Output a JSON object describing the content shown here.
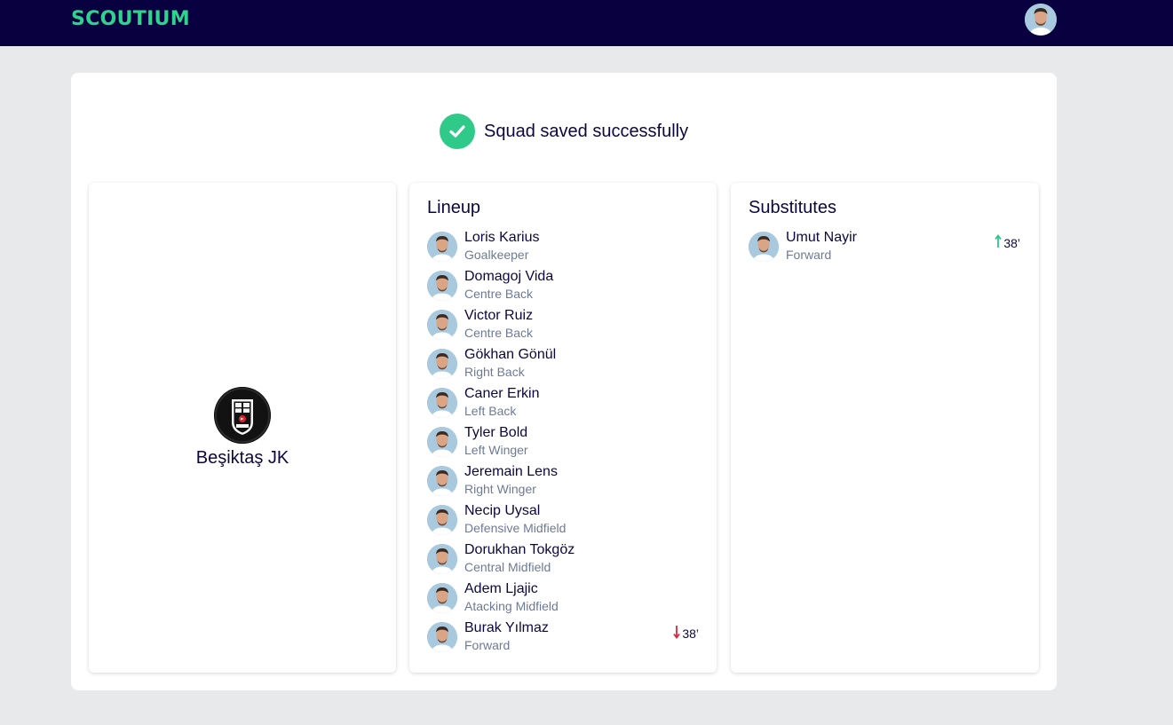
{
  "header": {
    "logo": "SCOUTIUM",
    "avatar_icon": "user-avatar-icon"
  },
  "status": {
    "message": "Squad saved successfully",
    "icon": "check-icon",
    "color": "#2fc98a"
  },
  "team": {
    "name": "Beşiktaş JK",
    "logo_icon": "besiktas-crest-icon"
  },
  "lineup": {
    "title": "Lineup",
    "players": [
      {
        "name": "Loris Karius",
        "position": "Goalkeeper"
      },
      {
        "name": "Domagoj Vida",
        "position": "Centre Back"
      },
      {
        "name": "Victor Ruiz",
        "position": "Centre Back"
      },
      {
        "name": "Gökhan Gönül",
        "position": "Right Back"
      },
      {
        "name": "Caner Erkin",
        "position": "Left Back"
      },
      {
        "name": "Tyler Bold",
        "position": "Left Winger"
      },
      {
        "name": "Jeremain Lens",
        "position": "Right Winger"
      },
      {
        "name": "Necip Uysal",
        "position": "Defensive Midfield"
      },
      {
        "name": "Dorukhan Tokgöz",
        "position": "Central Midfield"
      },
      {
        "name": "Adem Ljajic",
        "position": "Atacking Midfield"
      },
      {
        "name": "Burak Yılmaz",
        "position": "Forward",
        "sub_out": "38’"
      }
    ]
  },
  "substitutes": {
    "title": "Substitutes",
    "players": [
      {
        "name": "Umut Nayir",
        "position": "Forward",
        "sub_in": "38’"
      }
    ]
  },
  "colors": {
    "header_bg": "#08003f",
    "brand": "#2fd38d",
    "sub_out": "#e0243a",
    "sub_in": "#2fc98a"
  }
}
